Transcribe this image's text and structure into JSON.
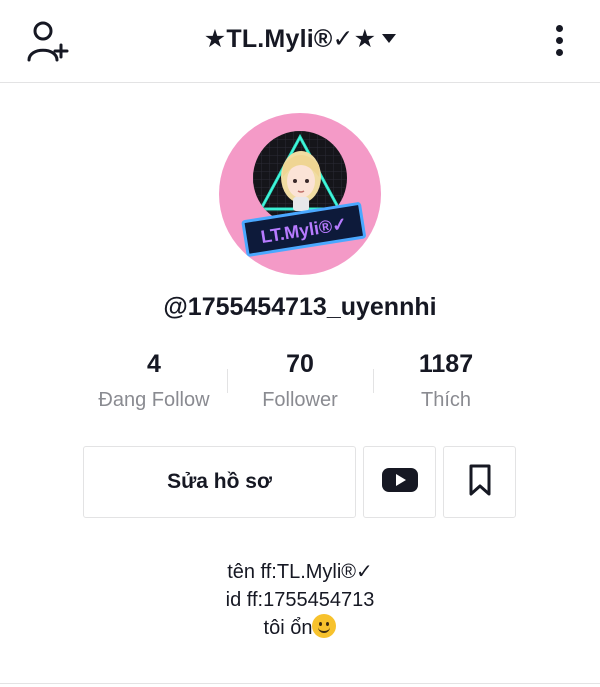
{
  "header": {
    "title": "★TL.Myli®✓★",
    "add_user_icon": "person-plus-icon",
    "more_icon": "vertical-dots-icon",
    "dropdown_icon": "caret-down-icon"
  },
  "profile": {
    "avatar_text": "LT.Myli®✓",
    "username": "@1755454713_uyennhi"
  },
  "stats": [
    {
      "value": "4",
      "label": "Đang Follow"
    },
    {
      "value": "70",
      "label": "Follower"
    },
    {
      "value": "1187",
      "label": "Thích"
    }
  ],
  "actions": {
    "edit_label": "Sửa hồ sơ",
    "youtube_icon": "youtube-icon",
    "bookmark_icon": "bookmark-icon"
  },
  "bio": {
    "line1": "tên ff:TL.Myli®✓",
    "line2": "id ff:1755454713",
    "line3": "tôi ổn"
  },
  "colors": {
    "avatar_bg": "#f49ac7",
    "text": "#161823",
    "muted": "#8a8b91",
    "border": "#e3e3e4"
  }
}
